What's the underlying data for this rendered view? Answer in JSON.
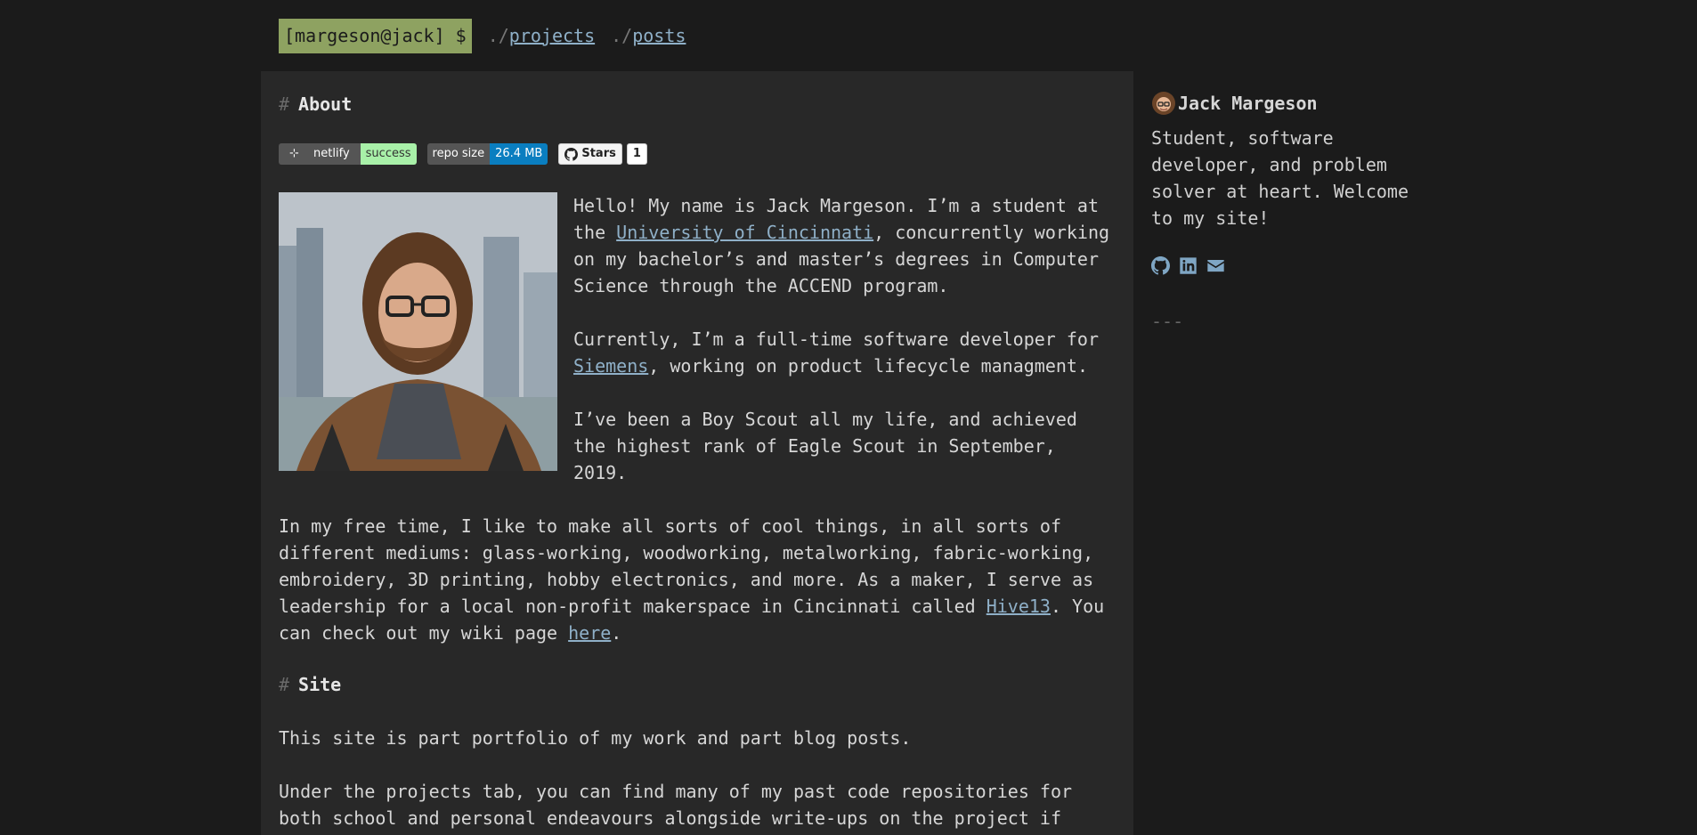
{
  "header": {
    "prompt": "[margeson@jack] $",
    "nav": [
      {
        "prefix": "./",
        "label": "projects"
      },
      {
        "prefix": "./",
        "label": "posts"
      }
    ]
  },
  "about": {
    "heading_hash": "#",
    "heading": "About",
    "badges": {
      "netlify_left": "netlify",
      "netlify_right": "success",
      "repo_left": "repo size",
      "repo_right": "26.4 MB",
      "stars_label": "Stars",
      "stars_count": "1"
    },
    "p1_a": "Hello! My name is Jack Margeson. I’m a student at the ",
    "p1_link": "University of Cincinnati",
    "p1_b": ", concurrently working on my bachelor’s and master’s degrees in Computer Science through the ACCEND program.",
    "p2_a": "Currently, I’m a full-time software developer for ",
    "p2_link": "Siemens",
    "p2_b": ", working on product lifecycle managment.",
    "p3": "I’ve been a Boy Scout all my life, and achieved the highest rank of Eagle Scout in September, 2019.",
    "p4_a": "In my free time, I like to make all sorts of cool things, in all sorts of different mediums: glass-working, woodworking, metalworking, fabric-working, embroidery, 3D printing, hobby electronics, and more. As a maker, I serve as leadership for a local non-profit makerspace in Cincinnati called ",
    "p4_link": "Hive13",
    "p4_b": ". You can check out my wiki page ",
    "p4_link2": "here",
    "p4_c": "."
  },
  "site": {
    "heading_hash": "#",
    "heading": "Site",
    "p1": "This site is part portfolio of my work and part blog posts.",
    "p2": "Under the projects tab, you can find many of my past code repositories for both school and personal endeavours alongside write-ups on the project if"
  },
  "sidebar": {
    "name": "Jack Margeson",
    "description": "Student, software developer, and problem solver at heart. Welcome to my site!",
    "icons": [
      "github-icon",
      "linkedin-icon",
      "email-icon"
    ],
    "separator": "---"
  },
  "colors": {
    "background": "#1b1b1b",
    "panel": "#282828",
    "prompt_bg": "#8ea261",
    "link": "#8fb0c8"
  }
}
